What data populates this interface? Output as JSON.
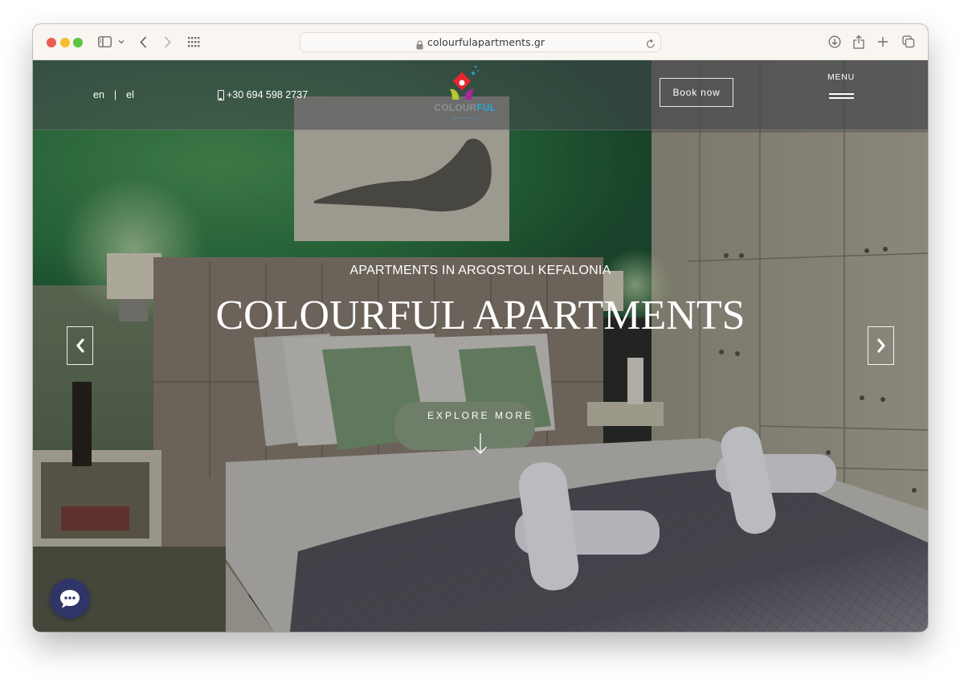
{
  "browser": {
    "url": "colourfulapartments.gr",
    "icons": {
      "sidebar": "sidebar-icon",
      "sidebar_menu": "chevron-down-icon",
      "back": "chevron-left-icon",
      "forward": "chevron-right-icon",
      "tab_overview": "grid-icon",
      "lock": "lock-icon",
      "reload": "reload-icon",
      "downloads": "download-icon",
      "share": "share-icon",
      "new_tab": "plus-icon",
      "tabs": "tabs-icon"
    }
  },
  "header": {
    "languages": [
      "en",
      "el"
    ],
    "language_separator": "|",
    "phone": "+30 694 598 2737",
    "logo": {
      "word_a": "COLOUR",
      "word_b": "FUL",
      "tagline": "apartments"
    },
    "book_label": "Book now",
    "menu_label": "MENU"
  },
  "hero": {
    "subtitle": "APARTMENTS IN ARGOSTOLI KEFALONIA",
    "title": "COLOURFUL APARTMENTS",
    "explore_label": "EXPLORE MORE"
  },
  "colors": {
    "chat_bubble": "#2f3566",
    "logo_red": "#e8262f",
    "logo_lime": "#b5c832",
    "logo_magenta": "#a8279a",
    "logo_blue": "#2aa7df"
  }
}
